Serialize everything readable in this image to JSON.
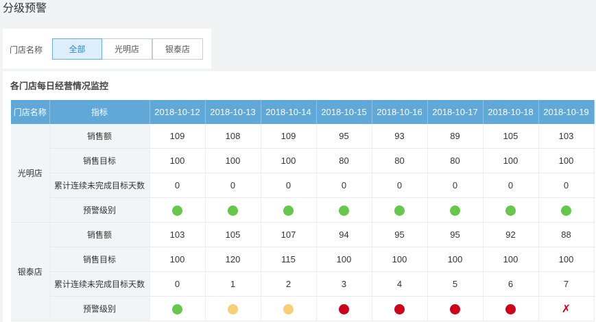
{
  "page": {
    "title": "分级预警"
  },
  "filter": {
    "label": "门店名称",
    "options": [
      {
        "label": "全部",
        "active": true
      },
      {
        "label": "光明店",
        "active": false
      },
      {
        "label": "银泰店",
        "active": false
      }
    ]
  },
  "panel": {
    "title": "各门店每日经营情况监控"
  },
  "table": {
    "header_store": "门店名称",
    "header_metric": "指标",
    "dates": [
      "2018-10-12",
      "2018-10-13",
      "2018-10-14",
      "2018-10-15",
      "2018-10-16",
      "2018-10-17",
      "2018-10-18",
      "2018-10-19"
    ],
    "metrics": [
      "销售额",
      "销售目标",
      "累计连续未完成目标天数",
      "预警级别"
    ],
    "stores": [
      {
        "name": "光明店",
        "sales": [
          "109",
          "108",
          "109",
          "95",
          "93",
          "89",
          "105",
          "103"
        ],
        "target": [
          "100",
          "100",
          "100",
          "80",
          "80",
          "80",
          "100",
          "100"
        ],
        "days": [
          "0",
          "0",
          "0",
          "0",
          "0",
          "0",
          "0",
          "0"
        ],
        "warning": [
          "green",
          "green",
          "green",
          "green",
          "green",
          "green",
          "green",
          "green"
        ]
      },
      {
        "name": "银泰店",
        "sales": [
          "103",
          "105",
          "107",
          "94",
          "95",
          "95",
          "92",
          "88"
        ],
        "target": [
          "100",
          "120",
          "115",
          "100",
          "100",
          "100",
          "100",
          "100"
        ],
        "days": [
          "0",
          "1",
          "2",
          "3",
          "4",
          "5",
          "6",
          "7"
        ],
        "warning": [
          "green",
          "yellow",
          "yellow",
          "red",
          "red",
          "red",
          "red",
          "x"
        ]
      }
    ]
  },
  "colors": {
    "header_bg": "#5fa8d8",
    "green": "#66c84a",
    "yellow": "#f8cf72",
    "red": "#d0021b",
    "active_seg": "#ddeefa"
  },
  "icons": {
    "green": "status-dot-green-icon",
    "yellow": "status-dot-yellow-icon",
    "red": "status-dot-red-icon",
    "x": "cross-mark-icon"
  }
}
